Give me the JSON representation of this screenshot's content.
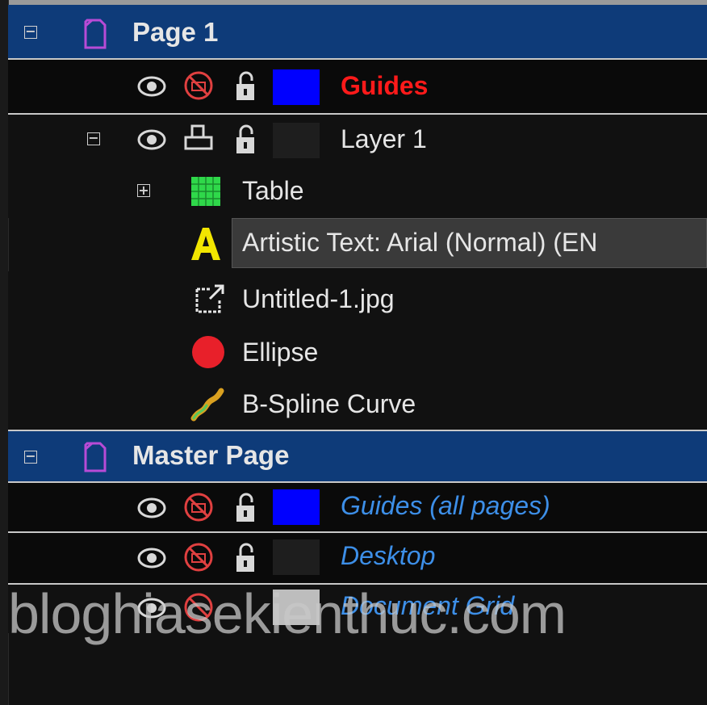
{
  "pages": [
    {
      "title": "Page 1",
      "layers": [
        {
          "name": "Guides",
          "swatch_color": "#0000ff",
          "style": "guides-red"
        },
        {
          "name": "Layer 1",
          "swatch_color": "#1e1e1e",
          "style": "normal"
        }
      ],
      "objects": [
        {
          "name": "Table",
          "icon": "table-icon",
          "expandable": true
        },
        {
          "name": "Artistic Text: Arial (Normal) (EN",
          "icon": "artistic-text-icon",
          "selected": true
        },
        {
          "name": "Untitled-1.jpg",
          "icon": "bitmap-icon"
        },
        {
          "name": "Ellipse",
          "icon": "ellipse-icon"
        },
        {
          "name": "B-Spline Curve",
          "icon": "bspline-curve-icon"
        }
      ]
    },
    {
      "title": "Master Page",
      "layers": [
        {
          "name": "Guides (all pages)",
          "swatch_color": "#0000ff",
          "style": "blue-italic"
        },
        {
          "name": "Desktop",
          "swatch_color": "#1e1e1e",
          "style": "blue-italic"
        },
        {
          "name": "Document Grid",
          "swatch_color": "#bdbdbd",
          "style": "blue-italic"
        }
      ]
    }
  ],
  "watermark": "bloghiasekienthuc.com",
  "colors": {
    "page_header_bg": "#0e3b79",
    "guides_label": "#ff1a1a",
    "master_layer_label": "#3d8fe8",
    "ellipse_fill": "#e8202a",
    "artistic_text_icon": "#f2e600",
    "table_icon": "#2fd84a"
  }
}
